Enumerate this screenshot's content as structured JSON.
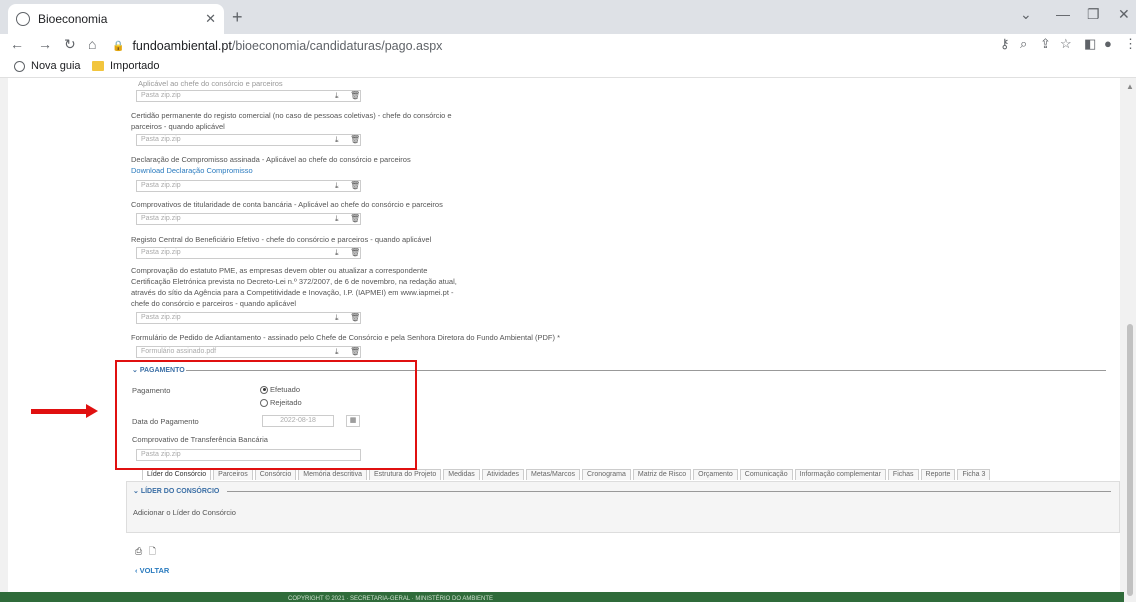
{
  "browser": {
    "tab_title": "Bioeconomia",
    "url_domain": "fundoambiental.pt",
    "url_path": "/bioeconomia/candidaturas/pago.aspx",
    "bookmarks": [
      "Nova guia",
      "Importado"
    ]
  },
  "form": {
    "top_partial_label": "Aplicável ao chefe do consórcio e parceiros",
    "file_placeholder": "Pasta zip.zip",
    "docs": [
      {
        "label": "Certidão permanente do registo comercial (no caso de pessoas coletivas) - chefe do consórcio e",
        "label2": "parceiros - quando aplicável"
      },
      {
        "label": "Declaração de Compromisso assinada - Aplicável ao chefe do consórcio e parceiros",
        "link": "Download Declaração Compromisso"
      },
      {
        "label": "Comprovativos de titularidade de conta bancária - Aplicável ao chefe do consórcio e parceiros"
      },
      {
        "label": "Registo Central do Beneficiário Efetivo - chefe do consórcio e parceiros - quando aplicável"
      },
      {
        "label": "Comprovação do estatuto PME, as empresas devem obter ou atualizar a correspondente",
        "label2": "Certificação Eletrónica prevista no Decreto-Lei n.º 372/2007, de 6 de novembro, na redação atual,",
        "label3": "através do sítio da Agência para a Competitividade e Inovação, I.P. (IAPMEI) em www.iapmei.pt -",
        "label4": "chefe do consórcio e parceiros - quando aplicável"
      },
      {
        "label": "Formulário de Pedido de Adiantamento - assinado pelo Chefe de Consórcio e pela Senhora Diretora do Fundo Ambiental (PDF) *",
        "placeholder": "Formulário assinado.pdf"
      }
    ]
  },
  "pagamento": {
    "section_title": "PAGAMENTO",
    "pagamento_label": "Pagamento",
    "opt_efetuado": "Efetuado",
    "opt_rejeitado": "Rejeitado",
    "data_label": "Data do Pagamento",
    "data_value": "2022-08-18",
    "comprovativo_label": "Comprovativo de Transferência Bancária",
    "comprovativo_placeholder": "Pasta zip.zip"
  },
  "tabs": [
    "Líder do Consórcio",
    "Parceiros",
    "Consórcio",
    "Memória descritiva",
    "Estrutura do Projeto",
    "Medidas",
    "Atividades",
    "Metas/Marcos",
    "Cronograma",
    "Matriz de Risco",
    "Orçamento",
    "Comunicação",
    "Informação complementar",
    "Fichas",
    "Reporte",
    "Ficha 3"
  ],
  "lider": {
    "section_title": "LÍDER DO CONSÓRCIO",
    "add_text": "Adicionar o Líder do Consórcio"
  },
  "voltar": "VOLTAR",
  "footer": "COPYRIGHT © 2021 · SECRETARIA-GERAL · MINISTÉRIO DO AMBIENTE"
}
